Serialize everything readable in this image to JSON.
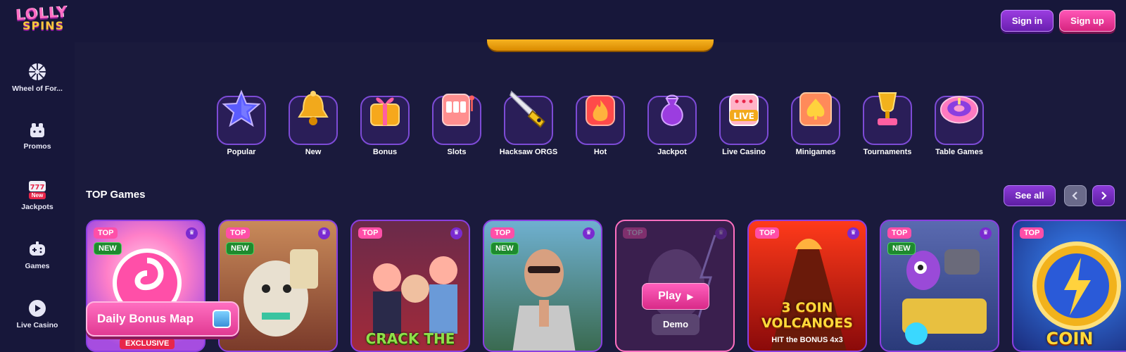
{
  "brand": {
    "line1": "LOLLY",
    "line2": "SPINS"
  },
  "header": {
    "signin_label": "Sign in",
    "signup_label": "Sign up"
  },
  "sidebar": {
    "items": [
      {
        "label": "Wheel of For...",
        "icon": "wheel-icon"
      },
      {
        "label": "Promos",
        "icon": "gift-icon"
      },
      {
        "label": "Jackpots",
        "icon": "slot-machine-icon",
        "badge": "New"
      },
      {
        "label": "Games",
        "icon": "gamepad-icon"
      },
      {
        "label": "Live Casino",
        "icon": "play-circle-icon"
      }
    ]
  },
  "categories": [
    {
      "label": "Popular",
      "icon": "star-icon"
    },
    {
      "label": "New",
      "icon": "bell-icon"
    },
    {
      "label": "Bonus",
      "icon": "gift-box-icon"
    },
    {
      "label": "Slots",
      "icon": "slot-machine-icon"
    },
    {
      "label": "Hacksaw ORGS",
      "icon": "saw-icon"
    },
    {
      "label": "Hot",
      "icon": "flame-icon"
    },
    {
      "label": "Jackpot",
      "icon": "money-bag-icon"
    },
    {
      "label": "Live Casino",
      "icon": "live-dice-icon",
      "art_text": "LIVE"
    },
    {
      "label": "Minigames",
      "icon": "spade-card-icon"
    },
    {
      "label": "Tournaments",
      "icon": "trophy-icon"
    },
    {
      "label": "Table Games",
      "icon": "roulette-icon"
    }
  ],
  "top_games": {
    "title": "TOP Games",
    "see_all_label": "See all",
    "cards": [
      {
        "top": "TOP",
        "new": "NEW",
        "exclusive": "EXCLUSIVE"
      },
      {
        "top": "TOP",
        "new": "NEW"
      },
      {
        "top": "TOP",
        "title_text": "CRACK THE"
      },
      {
        "top": "TOP",
        "new": "NEW"
      },
      {
        "top": "TOP",
        "hover": true
      },
      {
        "top": "TOP",
        "title_text": "3 COIN VOLCANOES",
        "subtitle_text": "HIT the BONUS 4x3"
      },
      {
        "top": "TOP",
        "new": "NEW"
      },
      {
        "top": "TOP",
        "title_text": "COIN"
      }
    ],
    "play_label": "Play",
    "demo_label": "Demo"
  },
  "daily_bonus": {
    "label": "Daily Bonus Map"
  },
  "colors": {
    "bg": "#17173a",
    "accent_pink": "#ff4fa8",
    "accent_purple": "#8d3bd8",
    "banner_gold": "#f7b321"
  }
}
